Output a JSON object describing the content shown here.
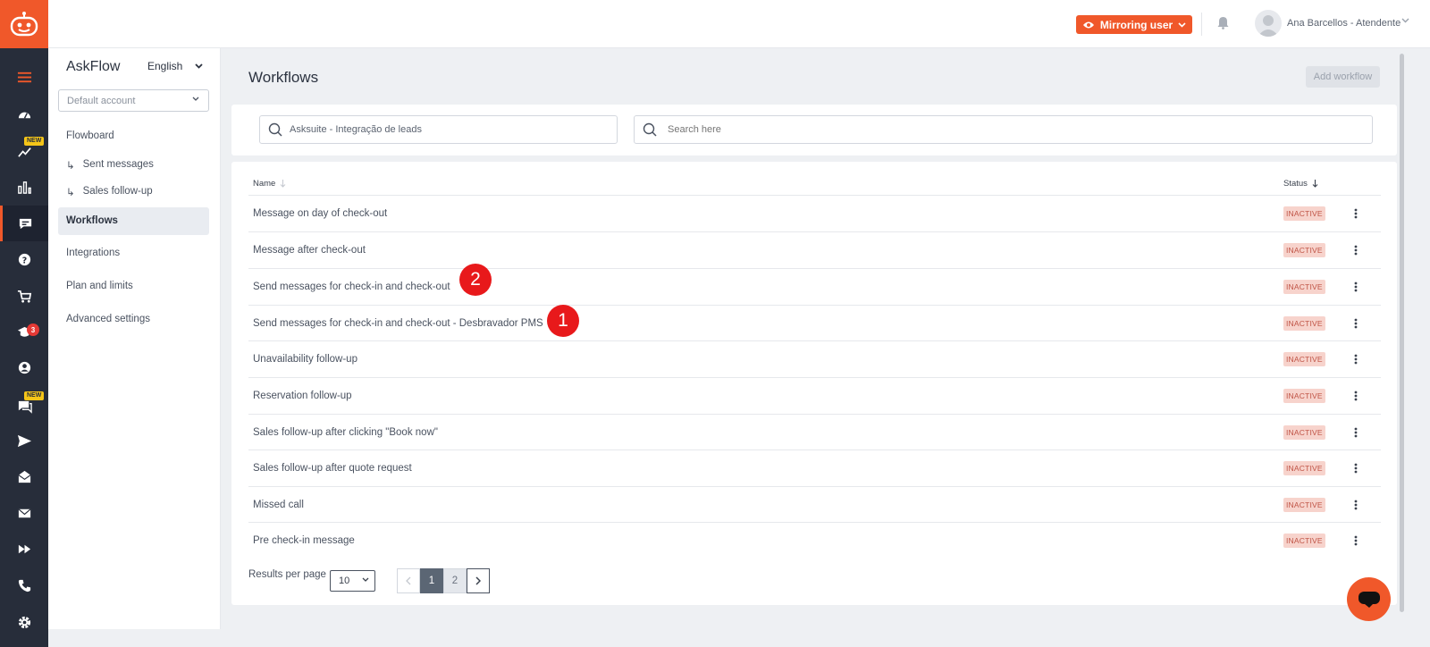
{
  "topbar": {
    "mirror_label": "Mirroring user",
    "user_name": "Ana Barcellos - Atendente"
  },
  "rail": {
    "items": [
      {
        "icon": "menu-icon",
        "active": false
      },
      {
        "icon": "dashboard-icon",
        "active": false
      },
      {
        "icon": "trend-icon",
        "active": false,
        "tag": "NEW"
      },
      {
        "icon": "bar-chart-icon",
        "active": false
      },
      {
        "icon": "flow-chat-icon",
        "active": true
      },
      {
        "icon": "help-icon",
        "active": false
      },
      {
        "icon": "cart-icon",
        "active": false
      },
      {
        "icon": "graduation-icon",
        "active": false,
        "badge": "3"
      },
      {
        "icon": "user-circle-icon",
        "active": false
      },
      {
        "icon": "chat-icon",
        "active": false,
        "tag": "NEW"
      },
      {
        "icon": "send-icon",
        "active": false
      },
      {
        "icon": "mail-open-icon",
        "active": false
      },
      {
        "icon": "mail-icon",
        "active": false
      },
      {
        "icon": "fast-forward-icon",
        "active": false
      },
      {
        "icon": "phone-icon",
        "active": false
      },
      {
        "icon": "settings-icon",
        "active": false
      }
    ]
  },
  "sidebar": {
    "title": "AskFlow",
    "language": "English",
    "account": "Default account",
    "nav": [
      {
        "label": "Flowboard",
        "sub": false
      },
      {
        "label": "Sent messages",
        "sub": true
      },
      {
        "label": "Sales follow-up",
        "sub": true
      },
      {
        "label": "Workflows",
        "sub": false,
        "active": true
      },
      {
        "label": "Integrations",
        "sub": false
      },
      {
        "label": "Plan and limits",
        "sub": false
      },
      {
        "label": "Advanced settings",
        "sub": false
      }
    ],
    "sub_arrow": "↳"
  },
  "main": {
    "title": "Workflows",
    "add_label": "Add workflow",
    "filter_value": "Asksuite - Integração de leads",
    "search_placeholder": "Search here",
    "columns": {
      "name": "Name",
      "status": "Status"
    },
    "rows": [
      {
        "name": "Message on day of check-out",
        "status": "INACTIVE"
      },
      {
        "name": "Message after check-out",
        "status": "INACTIVE"
      },
      {
        "name": "Send messages for check-in and check-out",
        "status": "INACTIVE"
      },
      {
        "name": "Send messages for check-in and check-out - Desbravador PMS",
        "status": "INACTIVE"
      },
      {
        "name": "Unavailability follow-up",
        "status": "INACTIVE"
      },
      {
        "name": "Reservation follow-up",
        "status": "INACTIVE"
      },
      {
        "name": "Sales follow-up after clicking \"Book now\"",
        "status": "INACTIVE"
      },
      {
        "name": "Sales follow-up after quote request",
        "status": "INACTIVE"
      },
      {
        "name": "Missed call",
        "status": "INACTIVE"
      },
      {
        "name": "Pre check-in message",
        "status": "INACTIVE"
      }
    ],
    "markers": [
      "2",
      "1"
    ],
    "results_per_page_label": "Results per page",
    "results_per_page": "10",
    "pages": [
      "1",
      "2"
    ],
    "current_page": "1"
  },
  "colors": {
    "brand": "#f0582a",
    "rail": "#272d3a",
    "inactive_bg": "#f7d3cc",
    "inactive_text": "#c05446",
    "marker": "#e8191b"
  }
}
